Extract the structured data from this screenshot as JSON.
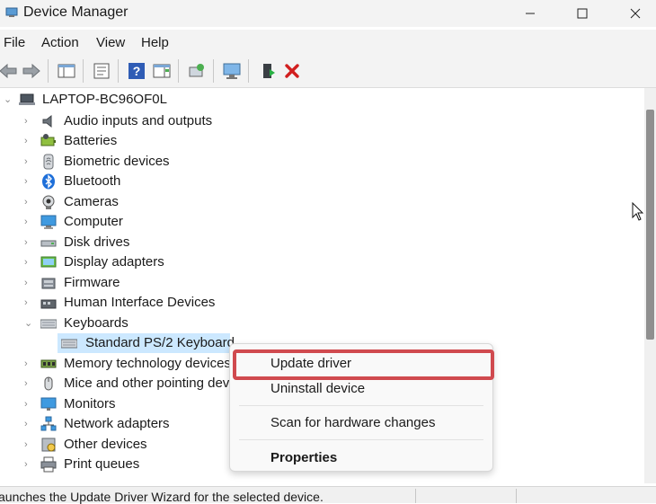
{
  "window": {
    "title": "Device Manager"
  },
  "menu": [
    "File",
    "Action",
    "View",
    "Help"
  ],
  "toolbar": {
    "buttons": [
      "back-icon",
      "forward-icon",
      "show-hide-tree-icon",
      "properties-icon",
      "help-icon",
      "action-pane-icon",
      "update-driver-icon",
      "scan-hardware-icon",
      "enable-device-icon",
      "uninstall-icon"
    ]
  },
  "tree": {
    "root": "LAPTOP-BC96OF0L",
    "categories": [
      {
        "label": "Audio inputs and outputs",
        "icon": "speaker-icon"
      },
      {
        "label": "Batteries",
        "icon": "battery-icon"
      },
      {
        "label": "Biometric devices",
        "icon": "biometric-icon"
      },
      {
        "label": "Bluetooth",
        "icon": "bluetooth-icon"
      },
      {
        "label": "Cameras",
        "icon": "camera-icon"
      },
      {
        "label": "Computer",
        "icon": "computer-icon"
      },
      {
        "label": "Disk drives",
        "icon": "disk-icon"
      },
      {
        "label": "Display adapters",
        "icon": "display-adapter-icon"
      },
      {
        "label": "Firmware",
        "icon": "firmware-icon"
      },
      {
        "label": "Human Interface Devices",
        "icon": "hid-icon"
      },
      {
        "label": "Keyboards",
        "icon": "keyboard-icon",
        "expanded": true
      },
      {
        "label": "Memory technology devices",
        "icon": "memory-icon"
      },
      {
        "label": "Mice and other pointing dev",
        "icon": "mouse-icon"
      },
      {
        "label": "Monitors",
        "icon": "monitor-icon"
      },
      {
        "label": "Network adapters",
        "icon": "network-icon"
      },
      {
        "label": "Other devices",
        "icon": "other-devices-icon"
      },
      {
        "label": "Print queues",
        "icon": "printer-icon"
      }
    ],
    "child": {
      "label": "Standard PS/2 Keyboard",
      "icon": "keyboard-icon"
    }
  },
  "context_menu": {
    "items": [
      "Update driver",
      "Uninstall device",
      "Scan for hardware changes",
      "Properties"
    ],
    "highlight_color": "#d04a4f"
  },
  "status": {
    "text": "aunches the Update Driver Wizard for the selected device."
  },
  "colors": {
    "selection": "#cce8ff",
    "delete_red": "#d11f1f"
  }
}
